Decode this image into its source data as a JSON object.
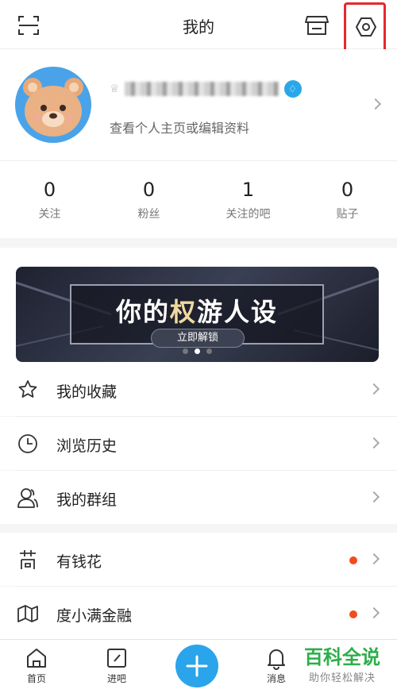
{
  "header": {
    "title": "我的"
  },
  "profile": {
    "username": "",
    "subtitle": "查看个人主页或编辑资料",
    "vip_badge": "♢"
  },
  "stats": [
    {
      "value": "0",
      "label": "关注"
    },
    {
      "value": "0",
      "label": "粉丝"
    },
    {
      "value": "1",
      "label": "关注的吧"
    },
    {
      "value": "0",
      "label": "贴子"
    }
  ],
  "banner": {
    "title_part1": "你的",
    "title_highlight": "权",
    "title_part2": "游人设",
    "button": "立即解锁",
    "page_count": 3,
    "active_page": 2
  },
  "menu": {
    "favorites": "我的收藏",
    "history": "浏览历史",
    "groups": "我的群组",
    "youqianhua": "有钱花",
    "duxiaoman": "度小满金融"
  },
  "tabbar": {
    "home": "首页",
    "enter_bar": "进吧",
    "messages": "消息"
  },
  "watermark": {
    "main": "百科全说",
    "sub": "助你轻松解决"
  },
  "colors": {
    "accent": "#2aa4ea",
    "highlight_box": "#e8262e",
    "notice_dot": "#f24b1d"
  }
}
